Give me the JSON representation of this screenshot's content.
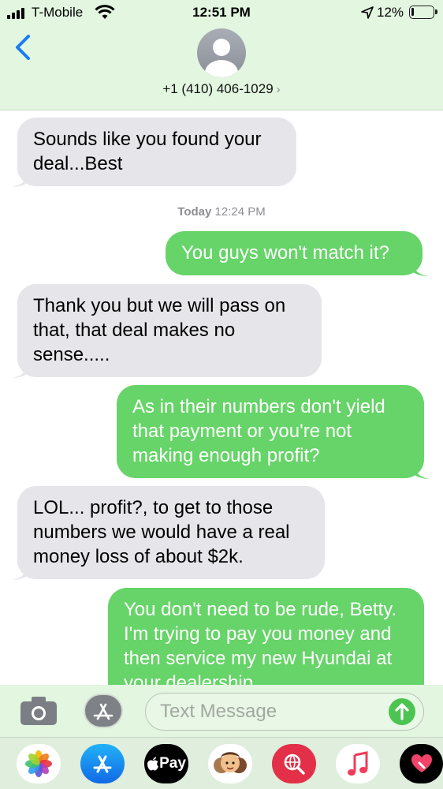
{
  "status_bar": {
    "carrier": "T-Mobile",
    "time": "12:51 PM",
    "battery_percent": "12%",
    "battery_level": 0.12
  },
  "header": {
    "contact": "+1 (410) 406-1029",
    "chevron": "›"
  },
  "messages": [
    {
      "direction": "incoming",
      "text": "Sounds like you found your deal...Best"
    },
    {
      "direction": "outgoing",
      "text": "You guys won't match it?"
    },
    {
      "direction": "incoming",
      "text": "Thank you but we will pass on that, that deal makes no sense....."
    },
    {
      "direction": "outgoing",
      "text": "As in their numbers don't yield that payment or you're not making enough profit?"
    },
    {
      "direction": "incoming",
      "text": "LOL... profit?, to get to those numbers we would have a real money loss of about $2k."
    },
    {
      "direction": "outgoing",
      "text": "You don't need to be rude, Betty.  I'm trying to pay you money and then service my new Hyundai at your dealership"
    }
  ],
  "timestamp": {
    "day": "Today",
    "time": "12:24 PM"
  },
  "composer": {
    "placeholder": "Text Message"
  },
  "app_drawer": {
    "apple_pay_label": "Pay",
    "apps": [
      "photos-icon",
      "app-store-icon",
      "apple-pay-icon",
      "memoji-icon",
      "web-search-icon",
      "music-icon",
      "digital-touch-icon"
    ]
  },
  "colors": {
    "header_bg": "#e2f6e0",
    "outgoing_bubble": "#66d468",
    "incoming_bubble": "#e5e5ea",
    "accent_blue": "#1a7cf5"
  }
}
